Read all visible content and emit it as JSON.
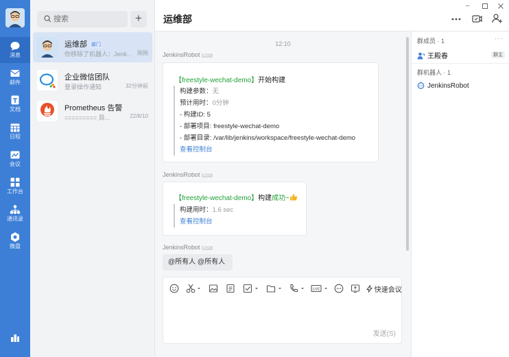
{
  "nav": {
    "items": [
      {
        "label": "消息"
      },
      {
        "label": "邮件"
      },
      {
        "label": "文档"
      },
      {
        "label": "日程"
      },
      {
        "label": "会议"
      },
      {
        "label": "工作台"
      },
      {
        "label": "通讯录"
      },
      {
        "label": "微盘"
      }
    ]
  },
  "search": {
    "placeholder": "搜索"
  },
  "conversations": [
    {
      "title": "运维部",
      "tag": "部门",
      "subtitle": "你移除了机器人：Jenk...",
      "time": "刚刚"
    },
    {
      "title": "企业微信团队",
      "subtitle": "登录操作通知",
      "time": "32分钟前"
    },
    {
      "title": "Prometheus 告警",
      "subtitle": "========= 异...",
      "time": "22/8/10"
    }
  ],
  "chat": {
    "title": "运维部",
    "time": "12:10",
    "bot_badge": "BOT",
    "messages": [
      {
        "sender": "JenkinsRobot",
        "head_project": "【freestyle-wechat-demo】",
        "head_text": "开始构建",
        "lines": [
          {
            "label": "构建参数：",
            "value": "无"
          },
          {
            "label": "预计用时：",
            "value": "0分钟"
          },
          {
            "label": "- 构建ID: 5",
            "value": ""
          },
          {
            "label": "- 部署项目: freestyle-wechat-demo",
            "value": ""
          },
          {
            "label": "- 部署目录: /var/lib/jenkins/workspace/freestyle-wechat-demo",
            "value": ""
          }
        ],
        "link": "查看控制台"
      },
      {
        "sender": "JenkinsRobot",
        "head_project": "【freestyle-wechat-demo】",
        "head_text": "构建",
        "head_status": "成功~",
        "lines": [
          {
            "label": "构建用时：",
            "value": "1.6 sec"
          }
        ],
        "link": "查看控制台"
      },
      {
        "sender": "JenkinsRobot",
        "text": "@所有人  @所有人"
      }
    ]
  },
  "composer": {
    "quick_meeting": "快速会议",
    "send_label": "发送(S)"
  },
  "members_panel": {
    "members_title": "群成员 · 1",
    "members": [
      {
        "name": "王殿春",
        "role": "群主"
      }
    ],
    "robots_title": "群机器人 · 1",
    "robots": [
      {
        "name": "JenkinsRobot"
      }
    ]
  }
}
